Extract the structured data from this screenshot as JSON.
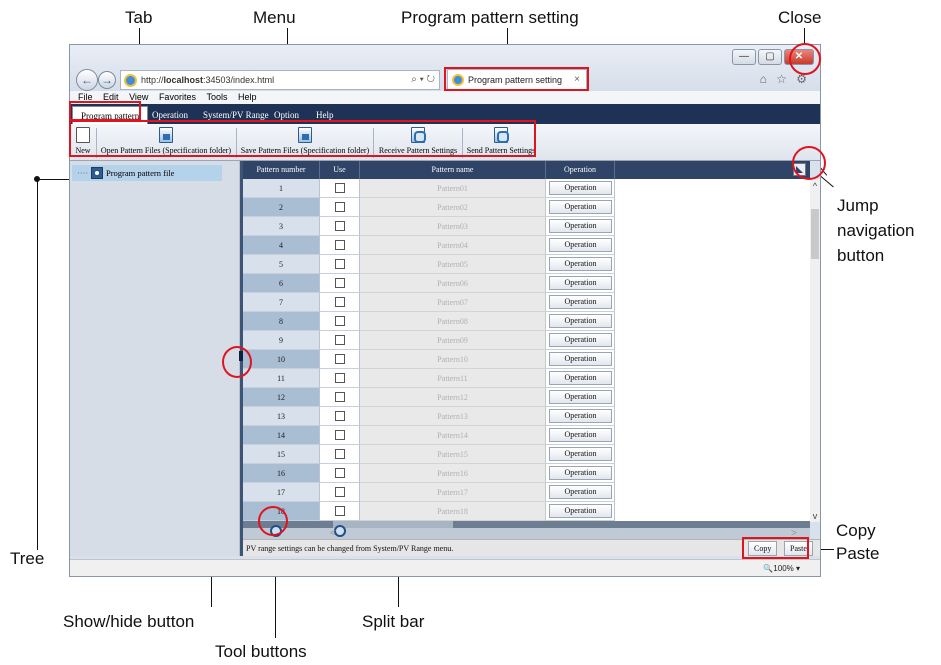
{
  "callouts": {
    "tab": "Tab",
    "menu": "Menu",
    "program_pattern_setting": "Program pattern setting",
    "close": "Close",
    "jump_nav_1": "Jump",
    "jump_nav_2": "navigation",
    "jump_nav_3": "button",
    "tree": "Tree",
    "copy": "Copy",
    "paste": "Paste",
    "show_hide": "Show/hide button",
    "split_bar": "Split bar",
    "tool_buttons": "Tool buttons"
  },
  "browser": {
    "address_prefix": "http://",
    "address_host": "localhost",
    "address_rest": ":34503/index.html",
    "search_glyph": "⌕ ▾ ↻",
    "tab_title": "Program pattern setting",
    "tab_close": "×",
    "menu": [
      "File",
      "Edit",
      "View",
      "Favorites",
      "Tools",
      "Help"
    ],
    "zoom": "🔍100%  ▾",
    "win_min": "—",
    "win_max": "▢",
    "win_close": "✕",
    "home_star_gear": "⌂ ☆ ⚙"
  },
  "app": {
    "tabs": [
      "Program pattern",
      "Operation",
      "System/PV Range",
      "Option",
      "Help"
    ],
    "toolbar": {
      "new": "New",
      "open": "Open Pattern Files (Specification folder)",
      "save": "Save Pattern Files (Specification folder)",
      "receive": "Receive Pattern Settings",
      "send": "Send Pattern Settings"
    },
    "tree_item": "Program pattern file",
    "tree_dash": "····",
    "columns": {
      "number": "Pattern number",
      "use": "Use",
      "name": "Pattern name",
      "operation": "Operation"
    },
    "rows": [
      {
        "num": "1",
        "name": "Pattern01",
        "op": "Operation"
      },
      {
        "num": "2",
        "name": "Pattern02",
        "op": "Operation"
      },
      {
        "num": "3",
        "name": "Pattern03",
        "op": "Operation"
      },
      {
        "num": "4",
        "name": "Pattern04",
        "op": "Operation"
      },
      {
        "num": "5",
        "name": "Pattern05",
        "op": "Operation"
      },
      {
        "num": "6",
        "name": "Pattern06",
        "op": "Operation"
      },
      {
        "num": "7",
        "name": "Pattern07",
        "op": "Operation"
      },
      {
        "num": "8",
        "name": "Pattern08",
        "op": "Operation"
      },
      {
        "num": "9",
        "name": "Pattern09",
        "op": "Operation"
      },
      {
        "num": "10",
        "name": "Pattern10",
        "op": "Operation"
      },
      {
        "num": "11",
        "name": "Pattern11",
        "op": "Operation"
      },
      {
        "num": "12",
        "name": "Pattern12",
        "op": "Operation"
      },
      {
        "num": "13",
        "name": "Pattern13",
        "op": "Operation"
      },
      {
        "num": "14",
        "name": "Pattern14",
        "op": "Operation"
      },
      {
        "num": "15",
        "name": "Pattern15",
        "op": "Operation"
      },
      {
        "num": "16",
        "name": "Pattern16",
        "op": "Operation"
      },
      {
        "num": "17",
        "name": "Pattern17",
        "op": "Operation"
      },
      {
        "num": "18",
        "name": "Pattern18",
        "op": "Operation"
      }
    ],
    "status_message": "PV range settings can be changed from System/PV Range menu.",
    "copy_button": "Copy",
    "paste_button": "Paste",
    "scroll_up": "^",
    "scroll_down": "v",
    "scroll_left": "<",
    "scroll_right": ">"
  },
  "colors": {
    "highlight": "#e0141e",
    "app_header": "#1e3256",
    "grid_header": "#2f4466"
  }
}
